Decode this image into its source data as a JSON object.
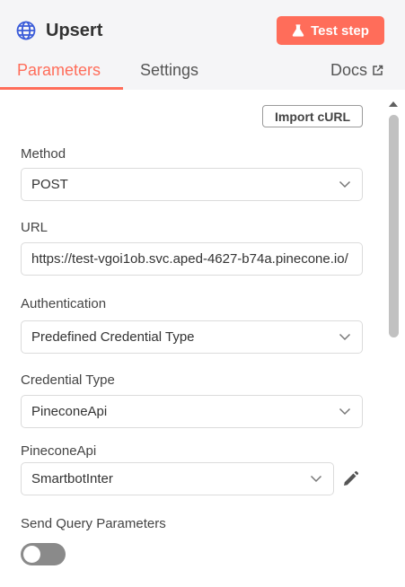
{
  "node": {
    "title": "Upsert",
    "icon": "globe-icon",
    "test_button_label": "Test step",
    "test_button_color": "#ff6d5a"
  },
  "tabs": {
    "parameters": "Parameters",
    "settings": "Settings",
    "docs": "Docs",
    "active": "parameters",
    "accent_color": "#ff6d5a"
  },
  "import_curl_label": "Import cURL",
  "fields": {
    "method": {
      "label": "Method",
      "value": "POST"
    },
    "url": {
      "label": "URL",
      "value": "https://test-vgoi1ob.svc.aped-4627-b74a.pinecone.io/"
    },
    "authentication": {
      "label": "Authentication",
      "value": "Predefined Credential Type"
    },
    "credential_type": {
      "label": "Credential Type",
      "value": "PineconeApi"
    },
    "pinecone_api": {
      "label": "PineconeApi",
      "value": "SmartbotInter"
    },
    "send_query_parameters": {
      "label": "Send Query Parameters",
      "enabled": false
    }
  }
}
